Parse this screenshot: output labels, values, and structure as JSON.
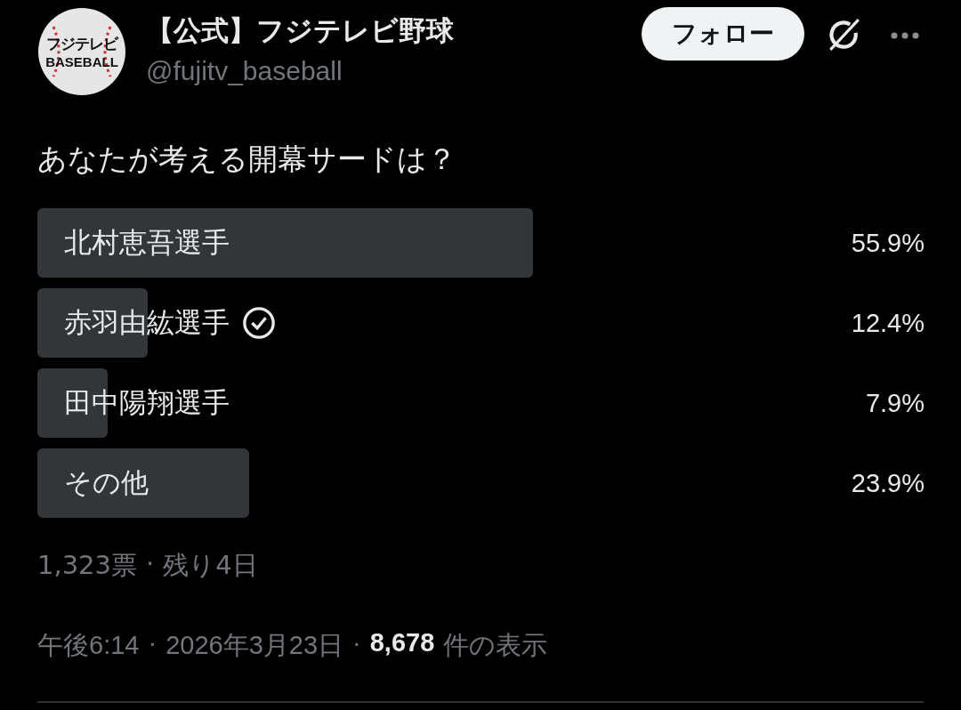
{
  "account": {
    "logo_lines": [
      "フジテレビ",
      "BASEBALL"
    ],
    "name": "【公式】フジテレビ野球",
    "handle": "@fujitv_baseball"
  },
  "follow_button": "フォロー",
  "question": "あなたが考える開幕サードは？",
  "poll": {
    "options": [
      {
        "label": "北村恵吾選手",
        "percent": "55.9%",
        "level": 0.559,
        "voted": false
      },
      {
        "label": "赤羽由紘選手",
        "percent": "12.4%",
        "level": 0.124,
        "voted": true
      },
      {
        "label": "田中陽翔選手",
        "percent": "7.9%",
        "level": 0.079,
        "voted": false
      },
      {
        "label": "その他",
        "percent": "23.9%",
        "level": 0.239,
        "voted": false
      }
    ],
    "votes": "1,323票",
    "separator": "·",
    "remaining": "残り4日"
  },
  "footer": {
    "time": "午後6:14",
    "date": "2026年3月23日",
    "separator": "·",
    "views": "8,678",
    "views_label": "件の表示"
  }
}
